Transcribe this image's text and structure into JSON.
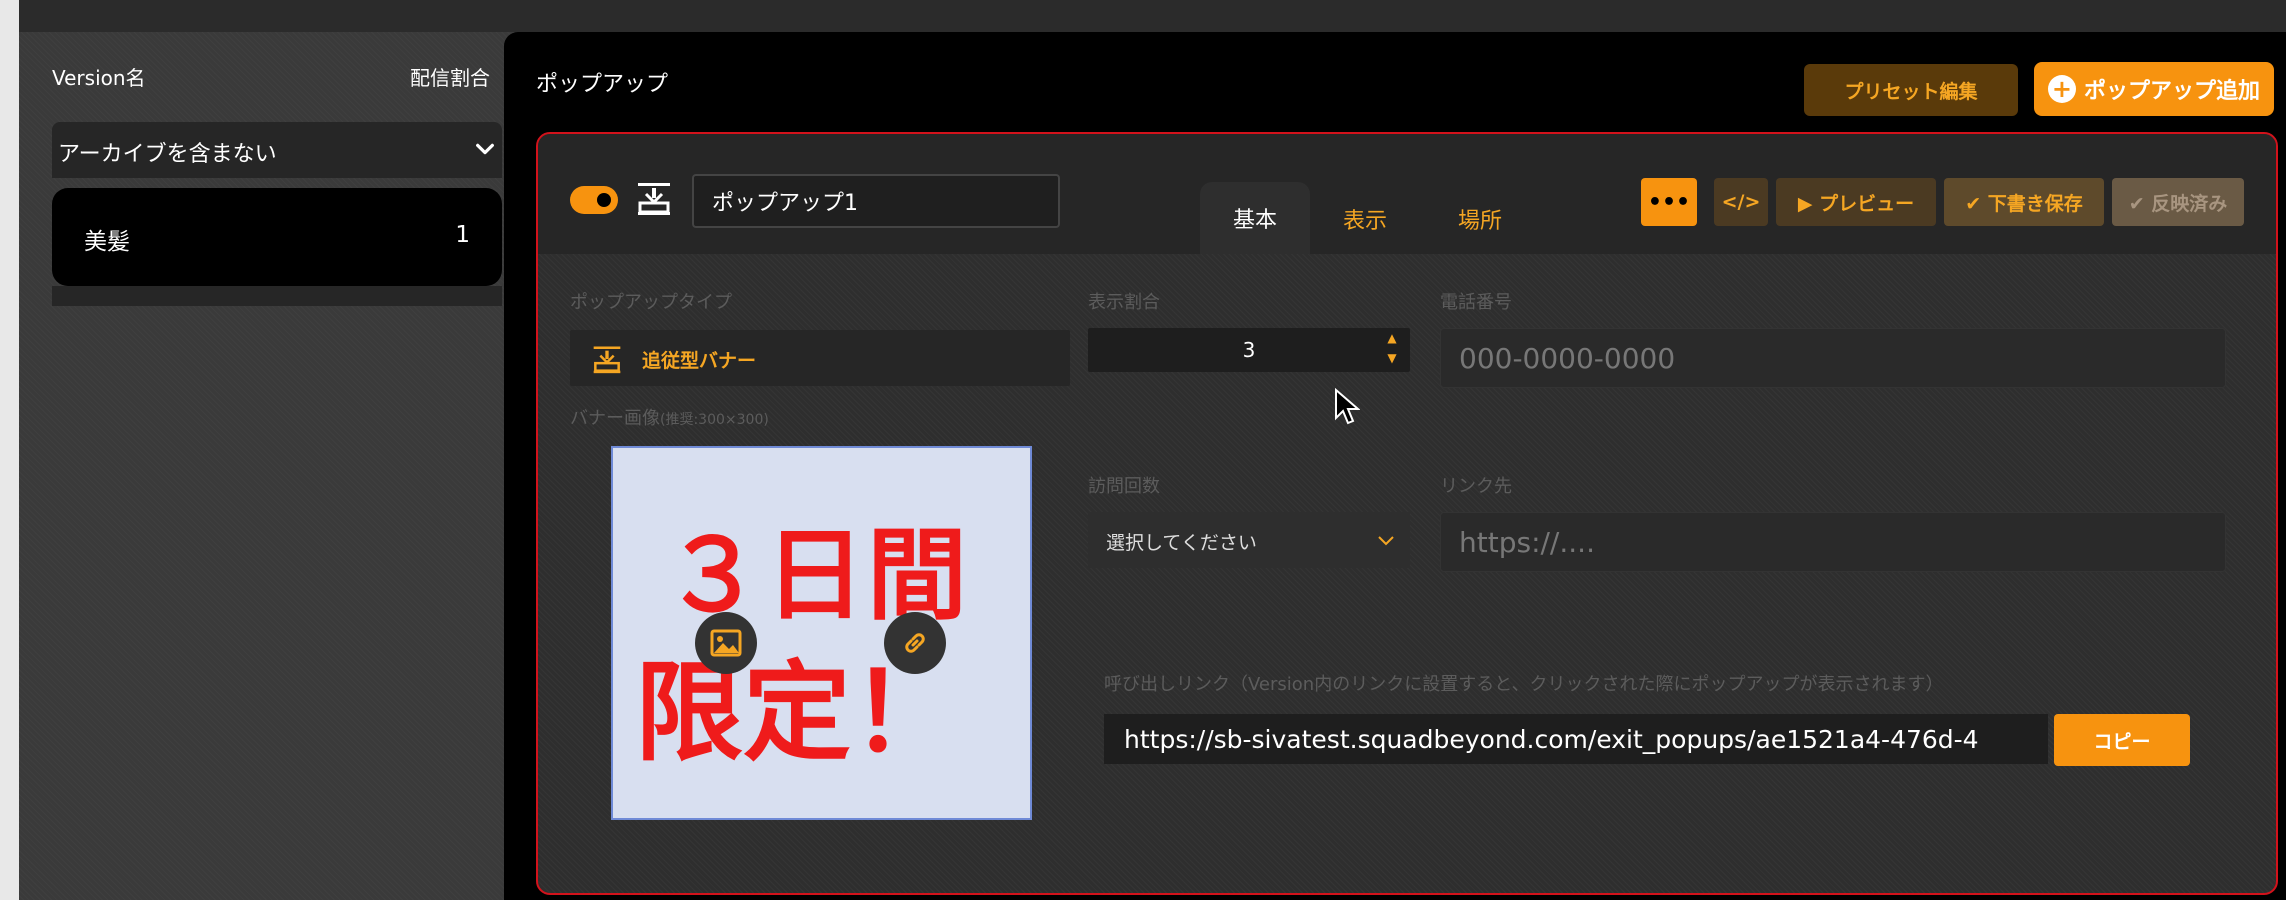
{
  "sidebar": {
    "version_name_header": "Version名",
    "ratio_header": "配信割合",
    "archive_filter": "アーカイブを含まない",
    "items": [
      {
        "name": "美髪",
        "count": "1"
      }
    ]
  },
  "main": {
    "title": "ポップアップ",
    "preset_edit_label": "プリセット編集",
    "add_popup_label": "ポップアップ追加"
  },
  "editor": {
    "popup_name": "ポップアップ1",
    "tabs": [
      {
        "label": "基本",
        "active": true
      },
      {
        "label": "表示",
        "active": false
      },
      {
        "label": "場所",
        "active": false
      }
    ],
    "more_label": "•••",
    "code_label": "</>",
    "preview_label": "▶ プレビュー",
    "draft_save_label": "✔ 下書き保存",
    "reflected_label": "✔ 反映済み",
    "fields": {
      "popup_type_label": "ポップアップタイプ",
      "popup_type_value": "追従型バナー",
      "display_ratio_label": "表示割合",
      "display_ratio_value": "3",
      "phone_label": "電話番号",
      "phone_placeholder": "000-0000-0000",
      "banner_image_label": "バナー画像",
      "banner_image_hint": "(推奨:300×300)",
      "visit_count_label": "訪問回数",
      "visit_count_value": "選択してください",
      "link_label": "リンク先",
      "link_placeholder": "https://....",
      "callout_link_label": "呼び出しリンク（Version内のリンクに設置すると、クリックされた際にポップアップが表示されます）",
      "callout_link_value": "https://sb-sivatest.squadbeyond.com/exit_popups/ae1521a4-476d-4",
      "copy_label": "コピー"
    },
    "banner": {
      "line1": "３日間",
      "line2": "限定！"
    }
  },
  "colors": {
    "accent": "#f7930f",
    "card_border": "#d3121b",
    "banner_text": "#ef1b1b"
  }
}
